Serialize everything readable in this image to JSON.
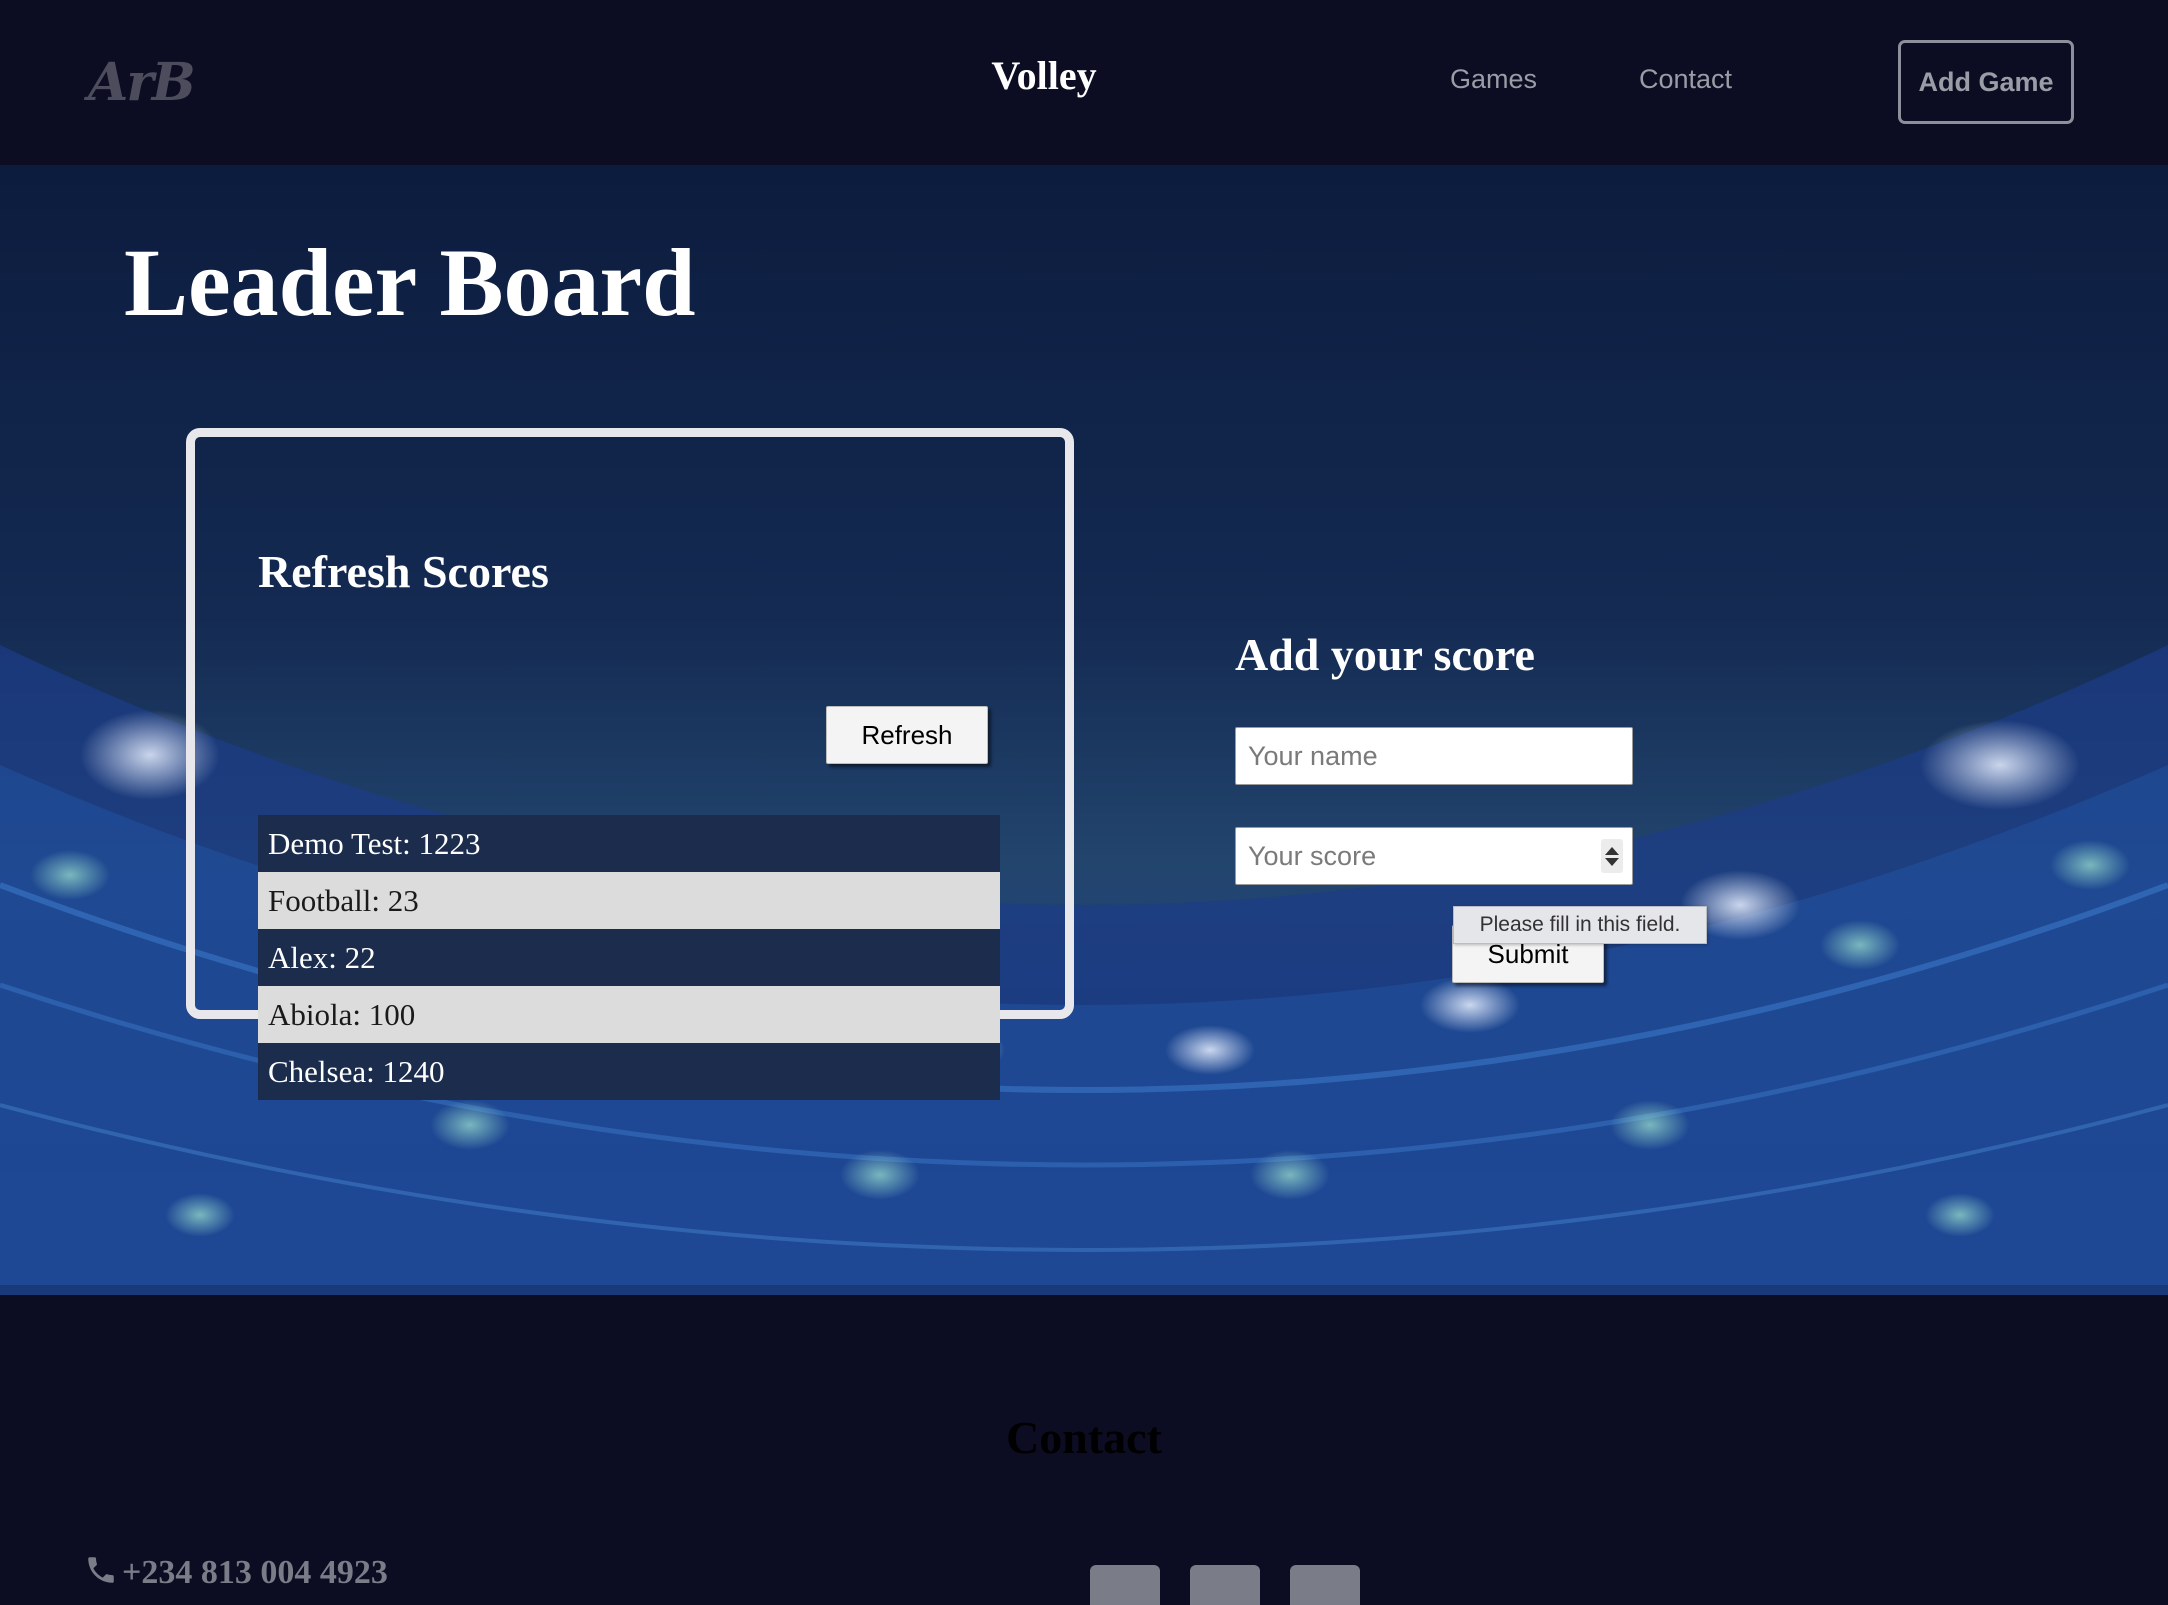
{
  "nav": {
    "logo": "ArB",
    "brand": "Volley",
    "links": [
      "Games",
      "Contact"
    ],
    "cta": "Add Game"
  },
  "hero": {
    "title": "Leader Board",
    "scores_card": {
      "title": "Refresh Scores",
      "refresh_label": "Refresh",
      "scores": [
        "Demo Test: 1223",
        "Football: 23",
        "Alex: 22",
        "Abiola: 100",
        "Chelsea: 1240"
      ]
    },
    "form": {
      "title": "Add your score",
      "name_placeholder": "Your name",
      "score_placeholder": "Your score",
      "submit_label": "Submit",
      "validation_message": "Please fill in this field."
    }
  },
  "footer": {
    "title": "Contact",
    "phone": "+234 813 004 4923",
    "icons": [
      "phone-icon",
      "social-icon-1",
      "social-icon-2",
      "social-icon-3"
    ]
  },
  "colors": {
    "nav_bg": "#0c0c22",
    "hero_dark": "#0c1c3e",
    "row_dark": "#1b2c4d",
    "row_light": "#dcdcdc",
    "muted_text": "#9a9ca6"
  }
}
